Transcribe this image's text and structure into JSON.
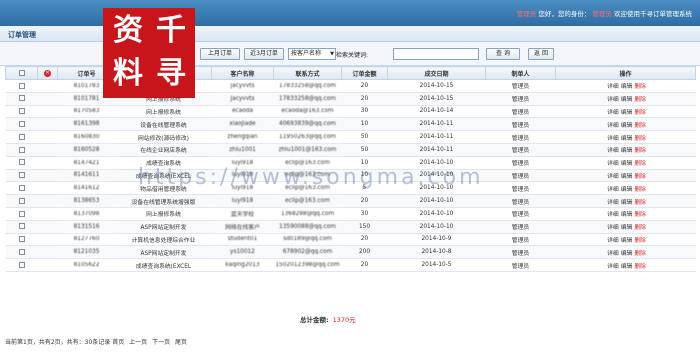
{
  "topbar": {
    "user_label": "管理员",
    "greeting": "您好，您的身份：",
    "role": "管理员",
    "welcome": "欢迎使用千寻订单管理系统"
  },
  "section": {
    "title": "订单管理"
  },
  "toolbar": {
    "last_month": "上月订单",
    "last3_month": "近3月订单",
    "select_value": "按客户名称",
    "keyword_label": "检索关键词:",
    "keyword_value": "",
    "search": "查 询",
    "back": "返 回"
  },
  "table": {
    "headers": [
      "订单号",
      "产品名称",
      "客户名称",
      "联系方式",
      "订单金额",
      "成交日期",
      "制单人",
      "操作"
    ],
    "rows": [
      {
        "id": "8101783",
        "product": "管理系统增强版",
        "client": "jacyvvts",
        "contact": "17833258@qq.com",
        "amount": "20",
        "date": "2014-10-15",
        "maker": "管理员"
      },
      {
        "id": "8101781",
        "product": "网上报修系统",
        "client": "jacyvvts",
        "contact": "17833258@qq.com",
        "amount": "20",
        "date": "2014-10-15",
        "maker": "管理员"
      },
      {
        "id": "8170583",
        "product": "网上报修系统",
        "client": "ecaoda",
        "contact": "ecaoda@163.com",
        "amount": "30",
        "date": "2014-10-14",
        "maker": "管理员"
      },
      {
        "id": "8161398",
        "product": "设备在线管理系统",
        "client": "xiaojiade",
        "contact": "40693839@qq.com",
        "amount": "10",
        "date": "2014-10-11",
        "maker": "管理员"
      },
      {
        "id": "8160830",
        "product": "网站修改(源码修改)",
        "client": "zhengqian",
        "contact": "11950263@qq.com",
        "amount": "50",
        "date": "2014-10-11",
        "maker": "管理员"
      },
      {
        "id": "8160528",
        "product": "在线企业网店系统",
        "client": "zhlu1001",
        "contact": "zhlu1001@163.com",
        "amount": "50",
        "date": "2014-10-11",
        "maker": "管理员"
      },
      {
        "id": "8147421",
        "product": "成绩查询系统",
        "client": "luyi918",
        "contact": "eclip@163.com",
        "amount": "10",
        "date": "2014-10-10",
        "maker": "管理员"
      },
      {
        "id": "8141611",
        "product": "成绩查询系统(EXCEL",
        "client": "luyi918",
        "contact": "eclip@163.com",
        "amount": "10",
        "date": "2014-10-10",
        "maker": "管理员"
      },
      {
        "id": "8141612",
        "product": "物品借用管理系统",
        "client": "luyi918",
        "contact": "eclip@163.com",
        "amount": "5",
        "date": "2014-10-10",
        "maker": "管理员"
      },
      {
        "id": "8138653",
        "product": "设备在线管理系统增强版",
        "client": "luyi918",
        "contact": "eclip@163.com",
        "amount": "20",
        "date": "2014-10-10",
        "maker": "管理员"
      },
      {
        "id": "8137098",
        "product": "网上报修系统",
        "client": "蓝天学校",
        "contact": "1368288@qq.com",
        "amount": "30",
        "date": "2014-10-10",
        "maker": "管理员"
      },
      {
        "id": "8131516",
        "product": "ASP网站定制开发",
        "client": "网络在线客户",
        "contact": "13590088@qq.com",
        "amount": "150",
        "date": "2014-10-10",
        "maker": "管理员"
      },
      {
        "id": "8127760",
        "product": "计算机信息处理综合作业",
        "client": "student01",
        "contact": "sd0189@qq.com",
        "amount": "20",
        "date": "2014-10-9",
        "maker": "管理员"
      },
      {
        "id": "8121035",
        "product": "ASP网站定制开发",
        "client": "ys10012",
        "contact": "678902@qq.com",
        "amount": "200",
        "date": "2014-10-8",
        "maker": "管理员"
      },
      {
        "id": "8105622",
        "product": "成绩查询系统(EXCEL",
        "client": "kaqing2013",
        "contact": "1502012398@qq.com",
        "amount": "20",
        "date": "2014-10-5",
        "maker": "管理员"
      }
    ],
    "op_detail": "详细",
    "op_edit": "编辑",
    "op_delete": "删除"
  },
  "total": {
    "label": "总计金额:",
    "value": "1370元"
  },
  "pager": {
    "summary": "当前第1页，共有2页，共有：30条记录",
    "first": "首页",
    "prev": "上一页",
    "next": "下一页",
    "last": "尾页"
  },
  "stamp": {
    "c1": "资",
    "c2": "千",
    "c3": "料",
    "c4": "寻"
  },
  "watermark": "https://www.songma.com",
  "colors": {
    "header_blue": "#2f6da3",
    "delete_red": "#d22",
    "stamp_red": "#c8151c"
  }
}
